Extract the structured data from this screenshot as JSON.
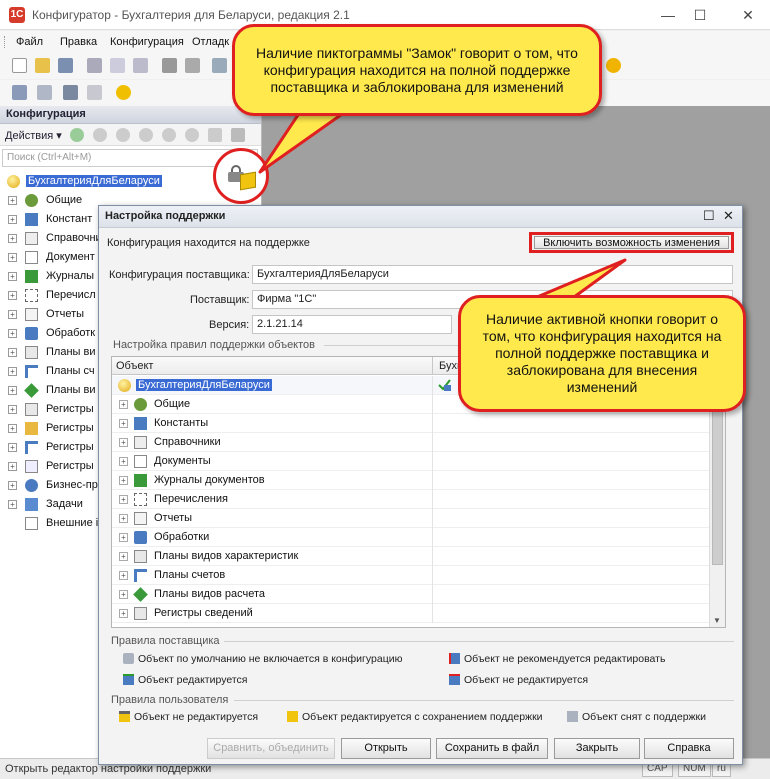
{
  "window": {
    "title": "Конфигуратор - Бухгалтерия для Беларуси, редакция 2.1",
    "app_icon": "1С",
    "controls": {
      "minimize": "—",
      "maximize": "☐",
      "close": "✕"
    }
  },
  "menu": {
    "items": [
      "Файл",
      "Правка",
      "Конфигурация",
      "Отладк"
    ]
  },
  "config_panel": {
    "title": "Конфигурация",
    "pin": "■",
    "actions_label": "Действия ▾",
    "search_placeholder": "Поиск (Ctrl+Alt+M)",
    "root": "БухгалтерияДляБеларуси",
    "items": [
      "Общие",
      "Констант",
      "Справочни",
      "Документ",
      "Журналы",
      "Перечисл",
      "Отчеты",
      "Обработк",
      "Планы ви",
      "Планы сч",
      "Планы ви",
      "Регистры",
      "Регистры",
      "Регистры",
      "Регистры",
      "Бизнес-пр",
      "Задачи",
      "Внешние і"
    ]
  },
  "status_bar": {
    "text": "Открыть редактор настройки поддержки",
    "indicators": [
      "CAP",
      "NUM",
      "ru"
    ]
  },
  "dialog": {
    "title": "Настройка поддержки",
    "controls": {
      "maximize": "☐",
      "close": "✕"
    },
    "support_status": "Конфигурация находится на поддержке",
    "enable_button": "Включить возможность изменения",
    "vendor_config_label": "Конфигурация поставщика:",
    "vendor_config_value": "БухгалтерияДляБеларуси",
    "vendor_label": "Поставщик:",
    "vendor_value": "Фирма \"1С\"",
    "version_label": "Версия:",
    "version_value": "2.1.21.14",
    "rules_section": "Настройка правил поддержки объектов",
    "grid": {
      "col_object": "Объект",
      "col_rule": "Бухг",
      "root": "БухгалтерияДляБеларуси",
      "rows": [
        "Общие",
        "Константы",
        "Справочники",
        "Документы",
        "Журналы документов",
        "Перечисления",
        "Отчеты",
        "Обработки",
        "Планы видов характеристик",
        "Планы счетов",
        "Планы видов расчета",
        "Регистры сведений"
      ]
    },
    "vendor_rules_section": "Правила поставщика",
    "vendor_rules": [
      "Объект по умолчанию не включается в конфигурацию",
      "Объект не рекомендуется редактировать",
      "Объект редактируется",
      "Объект не редактируется"
    ],
    "user_rules_section": "Правила пользователя",
    "user_rules": [
      "Объект не редактируется",
      "Объект редактируется с сохранением поддержки",
      "Объект снят с поддержки"
    ],
    "buttons": {
      "compare": "Сравнить, объединить",
      "open": "Открыть",
      "save": "Сохранить в файл",
      "close": "Закрыть",
      "help": "Справка"
    }
  },
  "callouts": {
    "lock": "Наличие пиктограммы  \"Замок\" говорит о том, что конфигурация находится на полной поддержке поставщика и заблокирована для изменений",
    "button": "Наличие активной кнопки говорит о том, что конфигурация находится на полной поддержке поставщика и заблокирована для внесения изменений"
  }
}
